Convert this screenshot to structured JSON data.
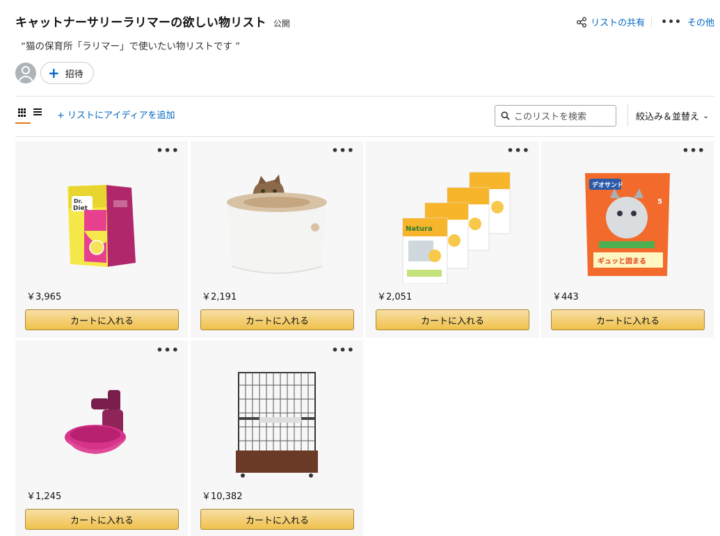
{
  "header": {
    "title": "キャットナーサリーラリマーの欲しい物リスト",
    "visibility": "公開",
    "subtitle": "“猫の保育所「ラリマー」で使いたい物リストです ”",
    "invite_label": "招待",
    "share_label": "リストの共有",
    "more_label": "その他"
  },
  "toolbar": {
    "add_idea_label": "+ リストにアイディアを追加",
    "search_placeholder": "このリストを検索",
    "filter_label": "絞込み＆並替え"
  },
  "items": [
    {
      "price": "￥3,965",
      "cart_label": "カートに入れる",
      "image": "cat-food-bag"
    },
    {
      "price": "￥2,191",
      "cart_label": "カートに入れる",
      "image": "cat-litter-box"
    },
    {
      "price": "￥2,051",
      "cart_label": "カートに入れる",
      "image": "natura-cat-litter-bags"
    },
    {
      "price": "￥443",
      "cart_label": "カートに入れる",
      "image": "deo-sand-litter-bag"
    },
    {
      "price": "￥1,245",
      "cart_label": "カートに入れる",
      "image": "pet-water-bowl"
    },
    {
      "price": "￥10,382",
      "cart_label": "カートに入れる",
      "image": "cat-cage"
    }
  ],
  "colors": {
    "link": "#0066c0",
    "button_top": "#f7dfa5",
    "button_bottom": "#f0c14b",
    "tab_accent": "#e47911"
  }
}
